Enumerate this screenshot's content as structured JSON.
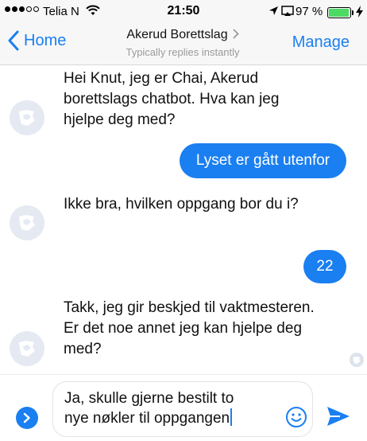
{
  "status_bar": {
    "carrier": "Telia N",
    "time": "21:50",
    "battery_percent": "97 %",
    "battery_level": 0.97,
    "signal_bars_filled": 3,
    "signal_bars_total": 5
  },
  "nav": {
    "back_label": "Home",
    "title": "Akerud Borettslag",
    "subtitle": "Typically replies instantly",
    "manage_label": "Manage"
  },
  "messages": [
    {
      "from": "bot",
      "text": "Hei Knut, jeg er Chai, Akerud borettslags chatbot. Hva kan jeg hjelpe deg med?"
    },
    {
      "from": "user",
      "text": "Lyset er gått utenfor"
    },
    {
      "from": "bot",
      "text": "Ikke bra, hvilken oppgang bor du i?"
    },
    {
      "from": "user",
      "text": "22"
    },
    {
      "from": "bot",
      "text": "Takk, jeg gir beskjed til vaktmesteren. Er det noe annet jeg kan hjelpe deg med?"
    }
  ],
  "composer": {
    "value": "Ja, skulle gjerne bestilt to\nnye nøkler til oppgangen"
  },
  "colors": {
    "accent": "#1a7ff0",
    "battery": "#4cd964",
    "avatar_bg": "#e4e9f2"
  },
  "icons": {
    "back": "chevron-left-icon",
    "expand": "chevron-right-circle-icon",
    "emoji": "smiley-icon",
    "send": "paper-plane-icon",
    "avatar": "bot-avatar-icon"
  }
}
